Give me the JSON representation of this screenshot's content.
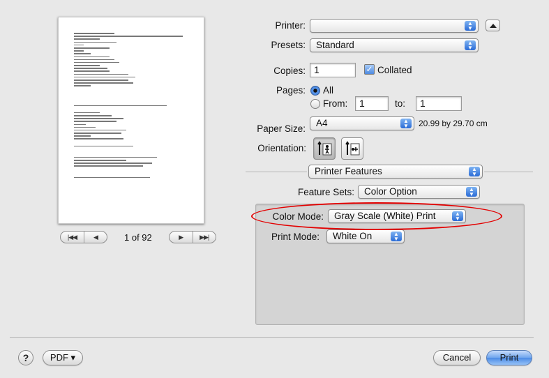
{
  "preview": {
    "page_indicator": "1 of 92",
    "nav": {
      "first": "|◀◀",
      "prev": "◀",
      "next": "▶",
      "last": "▶▶|"
    }
  },
  "printer": {
    "label": "Printer:",
    "value": ""
  },
  "presets": {
    "label": "Presets:",
    "value": "Standard"
  },
  "copies": {
    "label": "Copies:",
    "value": "1",
    "collated_label": "Collated",
    "collated": true
  },
  "pages": {
    "label": "Pages:",
    "all_label": "All",
    "from_label": "From:",
    "from_value": "1",
    "to_label": "to:",
    "to_value": "1",
    "selected": "All"
  },
  "paper_size": {
    "label": "Paper Size:",
    "value": "A4",
    "dimensions": "20.99 by 29.70 cm"
  },
  "orientation": {
    "label": "Orientation:",
    "selected": "portrait"
  },
  "section_popup": {
    "value": "Printer Features"
  },
  "feature_sets": {
    "label": "Feature Sets:",
    "value": "Color Option"
  },
  "color_mode": {
    "label": "Color Mode:",
    "value": "Gray Scale (White) Print"
  },
  "print_mode": {
    "label": "Print Mode:",
    "value": "White On"
  },
  "footer": {
    "help": "?",
    "pdf": "PDF ▾",
    "cancel": "Cancel",
    "print": "Print"
  },
  "colors": {
    "accent": "#4c8be5",
    "highlight": "#e30000",
    "window_bg": "#e8e8e8"
  }
}
